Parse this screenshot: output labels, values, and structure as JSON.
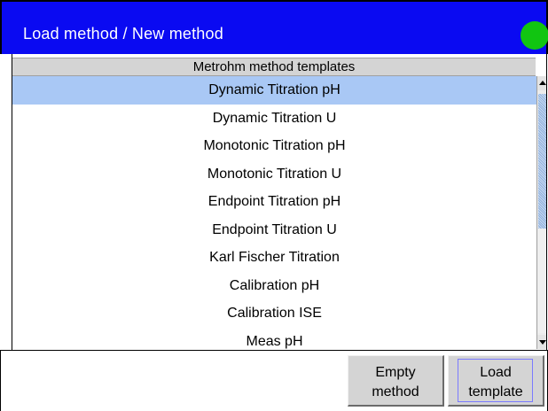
{
  "window": {
    "title": "Load method / New method",
    "status_color": "#11c511",
    "title_bg": "#0a0af2"
  },
  "list": {
    "header": "Metrohm method templates",
    "selected_index": 0,
    "items": [
      "Dynamic Titration pH",
      "Dynamic Titration U",
      "Monotonic Titration pH",
      "Monotonic Titration U",
      "Endpoint Titration pH",
      "Endpoint Titration U",
      "Karl Fischer Titration",
      "Calibration pH",
      "Calibration ISE",
      "Meas pH"
    ]
  },
  "buttons": {
    "empty_method": {
      "line1": "Empty",
      "line2": "method"
    },
    "load_template": {
      "line1": "Load",
      "line2": "template"
    }
  },
  "icons": {
    "scroll_up": "arrow-up-icon",
    "scroll_down": "arrow-down-icon",
    "status": "status-dot-icon"
  }
}
